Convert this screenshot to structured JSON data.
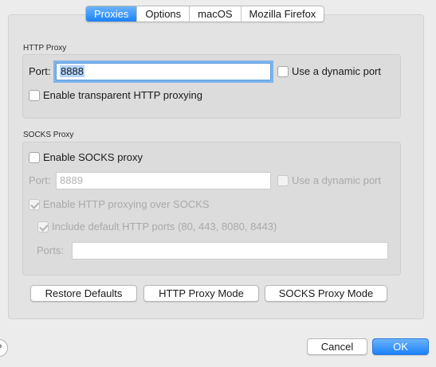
{
  "tabs": [
    {
      "label": "Proxies",
      "active": true
    },
    {
      "label": "Options",
      "active": false
    },
    {
      "label": "macOS",
      "active": false
    },
    {
      "label": "Mozilla Firefox",
      "active": false
    }
  ],
  "http_proxy": {
    "title": "HTTP Proxy",
    "port_label": "Port:",
    "port_value": "8888",
    "dynamic_port_label": "Use a dynamic port",
    "dynamic_port_checked": false,
    "transparent_label": "Enable transparent HTTP proxying",
    "transparent_checked": false
  },
  "socks_proxy": {
    "title": "SOCKS Proxy",
    "enable_label": "Enable SOCKS proxy",
    "enable_checked": false,
    "port_label": "Port:",
    "port_value": "8889",
    "dynamic_port_label": "Use a dynamic port",
    "http_over_socks_label": "Enable HTTP proxying over SOCKS",
    "http_over_socks_checked": true,
    "include_default_ports_label": "Include default HTTP ports (80, 443, 8080, 8443)",
    "include_default_ports_checked": true,
    "ports_label": "Ports:",
    "ports_value": ""
  },
  "buttons": {
    "restore_defaults": "Restore Defaults",
    "http_proxy_mode": "HTTP Proxy Mode",
    "socks_proxy_mode": "SOCKS Proxy Mode",
    "cancel": "Cancel",
    "ok": "OK"
  },
  "help_icon": "question-mark-icon",
  "colors": {
    "accent": "#1a82fb",
    "focus_ring": "#7fb3ec",
    "selection": "#b3d4fc"
  }
}
